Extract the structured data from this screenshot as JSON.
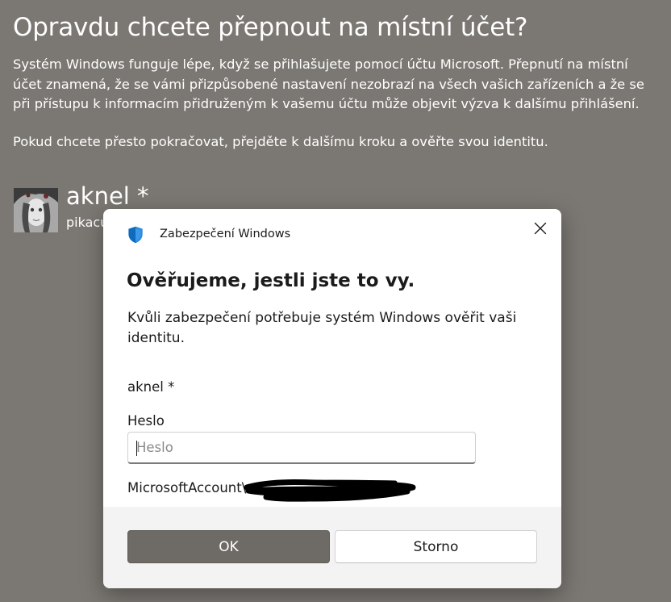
{
  "background": {
    "title": "Opravdu chcete přepnout na místní účet?",
    "paragraph1": "Systém Windows funguje lépe, když se přihlašujete pomocí účtu Microsoft. Přepnutí na místní účet znamená, že se vámi přizpůsobené nastavení nezobrazí na všech vašich zařízeních a že se při přístupu k informacím přidruženým k vašemu účtu může objevit výzva k dalšímu přihlášení.",
    "paragraph2": "Pokud chcete přesto pokračovat, přejděte k dalšímu kroku a ověřte svou identitu.",
    "account_name": "aknel *",
    "account_email": "pikacu"
  },
  "dialog": {
    "app_title": "Zabezpečení Windows",
    "heading": "Ověřujeme, jestli jste to vy.",
    "description": "Kvůli zabezpečení potřebuje systém Windows ověřit vaši identitu.",
    "user": "aknel *",
    "password_label": "Heslo",
    "password_placeholder": "Heslo",
    "password_value": "",
    "account_label": "MicrosoftAccount\\",
    "ok_label": "OK",
    "cancel_label": "Storno"
  },
  "colors": {
    "background": "#7b7873",
    "accent_button": "#6e6b66",
    "shield": "#0f6cbd"
  },
  "icons": {
    "shield": "shield-icon",
    "close": "close-icon"
  }
}
